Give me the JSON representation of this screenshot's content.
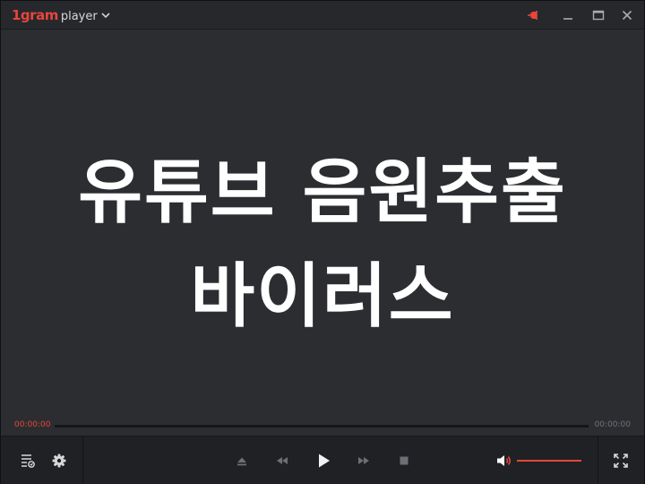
{
  "app": {
    "brand": "1gram",
    "product": "player"
  },
  "video": {
    "subtitle_line1": "유튜브 음원추출",
    "subtitle_line2": "바이러스"
  },
  "seek": {
    "current_time": "00:00:00",
    "total_time": "00:00:00",
    "progress": 0
  },
  "volume": {
    "level": 1.0
  },
  "icons": {
    "menu": "chevron-down-icon",
    "pin": "pin-icon",
    "minimize": "minimize-icon",
    "maximize": "maximize-icon",
    "close": "close-icon",
    "playlist": "playlist-icon",
    "settings": "gear-icon",
    "eject": "eject-icon",
    "rewind": "rewind-icon",
    "play": "play-icon",
    "forward": "fast-forward-icon",
    "stop": "stop-icon",
    "speaker": "speaker-icon",
    "fullscreen": "fullscreen-icon"
  },
  "colors": {
    "accent": "#e8453c",
    "background": "#2b2d31",
    "titlebar": "#26282c",
    "controlbar": "#1f2124",
    "text": "#ffffff"
  }
}
